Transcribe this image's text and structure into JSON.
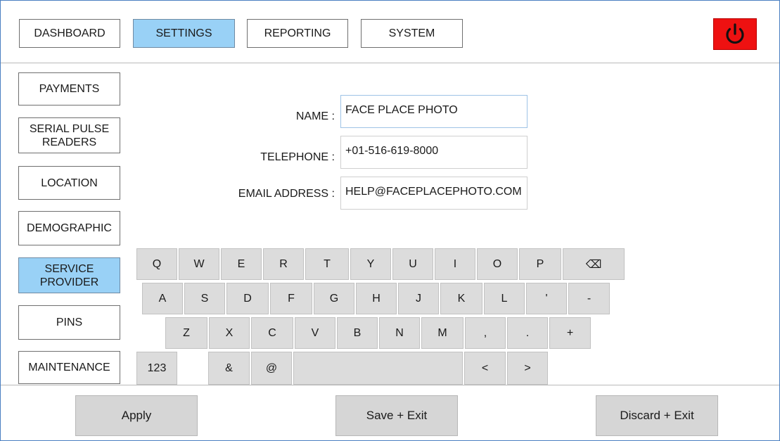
{
  "nav": {
    "tabs": [
      {
        "label": "DASHBOARD",
        "active": false
      },
      {
        "label": "SETTINGS",
        "active": true
      },
      {
        "label": "REPORTING",
        "active": false
      },
      {
        "label": "SYSTEM",
        "active": false
      }
    ],
    "power_icon": "power-icon",
    "power_color": "#ee1111",
    "active_color": "#99d1f6"
  },
  "sidebar": {
    "items": [
      {
        "label": "PAYMENTS",
        "active": false
      },
      {
        "label": "SERIAL PULSE\nREADERS",
        "active": false
      },
      {
        "label": "LOCATION",
        "active": false
      },
      {
        "label": "DEMOGRAPHIC",
        "active": false
      },
      {
        "label": "SERVICE\nPROVIDER",
        "active": true
      },
      {
        "label": "PINS",
        "active": false
      },
      {
        "label": "MAINTENANCE",
        "active": false
      }
    ]
  },
  "form": {
    "name_label": "NAME :",
    "name_value": "FACE PLACE PHOTO",
    "telephone_label": "TELEPHONE :",
    "telephone_value": "+01-516-619-8000",
    "email_label": "EMAIL ADDRESS :",
    "email_value": "HELP@FACEPLACEPHOTO.COM"
  },
  "keyboard": {
    "rows": [
      [
        "Q",
        "W",
        "E",
        "R",
        "T",
        "Y",
        "U",
        "I",
        "O",
        "P",
        "⌫"
      ],
      [
        "A",
        "S",
        "D",
        "F",
        "G",
        "H",
        "J",
        "K",
        "L",
        "'",
        "-"
      ],
      [
        "Z",
        "X",
        "C",
        "V",
        "B",
        "N",
        "M",
        ",",
        ".",
        "+"
      ],
      [
        "123",
        "&",
        "@",
        " ",
        "<",
        ">"
      ]
    ]
  },
  "actions": {
    "apply": "Apply",
    "save_exit": "Save + Exit",
    "discard_exit": "Discard + Exit"
  }
}
